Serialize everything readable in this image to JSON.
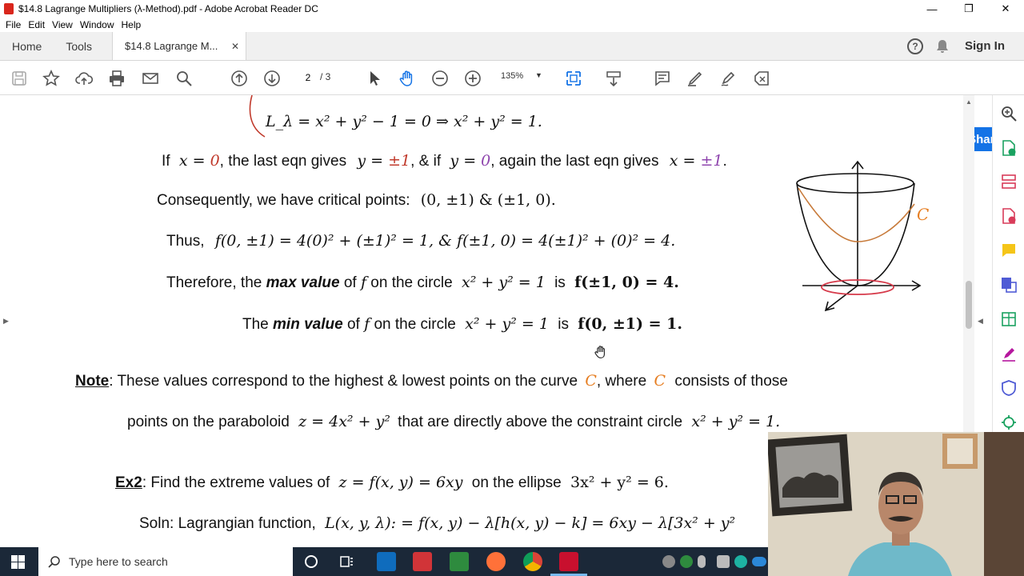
{
  "window": {
    "title": "$14.8 Lagrange Multipliers (λ-Method).pdf - Adobe Acrobat Reader DC",
    "controls": [
      "—",
      "❐",
      "✕"
    ]
  },
  "menu": [
    "File",
    "Edit",
    "View",
    "Window",
    "Help"
  ],
  "tabs": {
    "home": "Home",
    "tools": "Tools",
    "document": "$14.8 Lagrange M...",
    "close": "✕"
  },
  "header_right": {
    "help": "?",
    "sign_in": "Sign In"
  },
  "toolbar": {
    "page_current": "2",
    "page_total": "/ 3",
    "zoom": "135%",
    "share": "Share"
  },
  "document": {
    "line1": "L_λ = x² + y² − 1 = 0 ⇒ x² + y² = 1.",
    "line2": {
      "a": "If",
      "b": "x",
      "c": " = ",
      "d": "0",
      "e": ", the last eqn gives",
      "f": "y",
      "g": " = ",
      "h": "±1",
      "i": ",  &   if",
      "j": "y",
      "k": " = ",
      "l": "0",
      "m": ", again the last eqn gives",
      "n": "x",
      "o": " = ",
      "p": "±1",
      "q": "."
    },
    "line3": {
      "a": "Consequently, we have critical points:",
      "b": "(0, ±1) & (±1, 0)."
    },
    "line4": {
      "a": "Thus,",
      "b": "f(0, ±1) = 4(0)² + (±1)² = 1,  &  f(±1, 0) = 4(±1)² + (0)² = 4."
    },
    "line5": {
      "a": "Therefore, the",
      "b": "max value",
      "c": "of",
      "d": "f",
      "e": "on the circle",
      "f": "x² + y² = 1",
      "g": "is",
      "h": "f(±1, 0) = 4."
    },
    "line6": {
      "a": "The",
      "b": "min value",
      "c": "of",
      "d": "f",
      "e": "on the circle",
      "f": "x² + y² = 1",
      "g": "is",
      "h": "f(0, ±1) = 1."
    },
    "note": {
      "label": "Note",
      "a": ": These values correspond to the highest & lowest points on the curve",
      "c1": "C",
      "b": ",  where",
      "c2": "C",
      "c": "consists of those"
    },
    "note2": {
      "a": "points on the paraboloid",
      "b": "z = 4x² + y²",
      "c": "that are directly above the constraint circle",
      "d": "x² + y² = 1."
    },
    "ex2": {
      "label": "Ex2",
      "a": ":  Find the extreme values of",
      "b": "z = f(x, y) = 6xy",
      "c": "on the ellipse",
      "d": "3x² + y² = 6."
    },
    "soln": {
      "a": "Soln:  Lagrangian function,",
      "b": "L(x, y, λ): = f(x, y) − λ[h(x, y) − k] = 6xy − λ[3x² + y²"
    },
    "figure_label": "C"
  },
  "taskbar": {
    "search_placeholder": "Type here to search"
  },
  "colors": {
    "accent": "#1473e6",
    "red": "#c0392b",
    "purple": "#8e44ad",
    "orange": "#e67e22",
    "taskbar": "#1b2838"
  }
}
